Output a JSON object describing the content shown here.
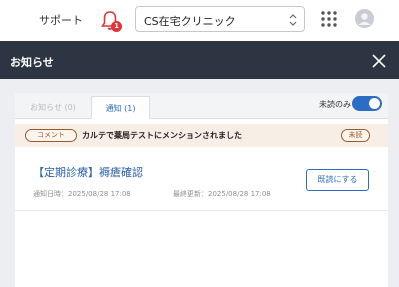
{
  "topbar": {
    "support_label": "サポート",
    "notification_count": "1",
    "clinic_select_value": "CS在宅クリニック"
  },
  "panel": {
    "title": "お知らせ",
    "tabs": [
      {
        "label": "お知らせ (0)"
      },
      {
        "label": "通知 (1)"
      }
    ],
    "unread_only_label": "未読のみ",
    "unread_only_enabled": true
  },
  "notice": {
    "tag_label": "コメント",
    "message": "カルテで薬局テストにメンションされました",
    "status_label": "未読"
  },
  "item": {
    "title": "【定期診療】褥瘡確認",
    "notified_at": "通知日時：2025/08/28 17:08",
    "updated_at": "最終更新：2025/08/28 17:08",
    "mark_read_label": "既読にする"
  },
  "colors": {
    "header_bg": "#2c3541",
    "accent": "#2b6cc4",
    "badge_red": "#e0343a",
    "tag_brown": "#9b5a2a"
  }
}
